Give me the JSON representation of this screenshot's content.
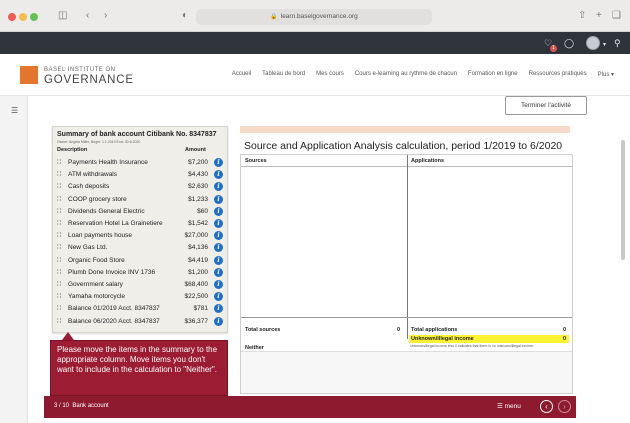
{
  "browser": {
    "url": "learn.baselgovernance.org"
  },
  "site": {
    "logo_small": "BASEL INSTITUTE ON",
    "logo_big": "GOVERNANCE",
    "nav": [
      "Accueil",
      "Tableau de bord",
      "Mes cours",
      "Cours e-learning au rythme de chacun",
      "Formation en ligne",
      "Ressources pratiques",
      "Plus ▾"
    ],
    "notification_count": "1"
  },
  "activity": {
    "end_button": "Terminer l'activité",
    "bank": {
      "title": "Summary of bank account Citibank No. 8347837",
      "subtitle": "Owner: Angela Miller, Begin: 1.1.2019 End: 30.6.2020",
      "col_description": "Description",
      "col_amount": "Amount",
      "items": [
        {
          "desc": "Payments Health Insurance",
          "amount": "$7,200"
        },
        {
          "desc": "ATM withdrawals",
          "amount": "$4,430"
        },
        {
          "desc": "Cash deposits",
          "amount": "$2,630"
        },
        {
          "desc": "COOP grocery store",
          "amount": "$1,233"
        },
        {
          "desc": "Dividends General Electric",
          "amount": "$60"
        },
        {
          "desc": "Reservation Hotel La Grainetiere",
          "amount": "$1,542"
        },
        {
          "desc": "Loan payments house",
          "amount": "$27,000"
        },
        {
          "desc": "New Gas Ltd.",
          "amount": "$4,136"
        },
        {
          "desc": "Organic Food Store",
          "amount": "$4,419"
        },
        {
          "desc": "Plumb Done Invoice INV 1736",
          "amount": "$1,200"
        },
        {
          "desc": "Government salary",
          "amount": "$68,400"
        },
        {
          "desc": "Yamaha motorcycle",
          "amount": "$22,500"
        },
        {
          "desc": "Balance 01/2019 Acct. 8347837",
          "amount": "$781"
        },
        {
          "desc": "Balance 06/2020 Acct. 8347837",
          "amount": "$36,377"
        }
      ]
    },
    "tooltip": "Please move the items in the summary to the appropriate column. Move items you don't want to include in the calculation to \"Neither\".",
    "calc": {
      "title": "Source and Application Analysis calculation, period 1/2019 to 6/2020",
      "sources_label": "Sources",
      "applications_label": "Applications",
      "total_sources_label": "Total sources",
      "total_sources_value": "0",
      "total_applications_label": "Total applications",
      "total_applications_value": "0",
      "unknown_label": "Unknown/illegal income",
      "unknown_value": "0",
      "unknown_note": "Unknown/illegal income less 0 indicates that there is no unknown/illegal income.",
      "neither_label": "Neither"
    },
    "footer": {
      "progress": "3 / 10",
      "section": "Bank account",
      "menu_label": "menu"
    }
  },
  "colors": {
    "accent_maroon": "#9b1c33",
    "logo_orange": "#e3762c",
    "info_blue": "#1f6fc5",
    "highlight_yellow": "#fff333"
  }
}
